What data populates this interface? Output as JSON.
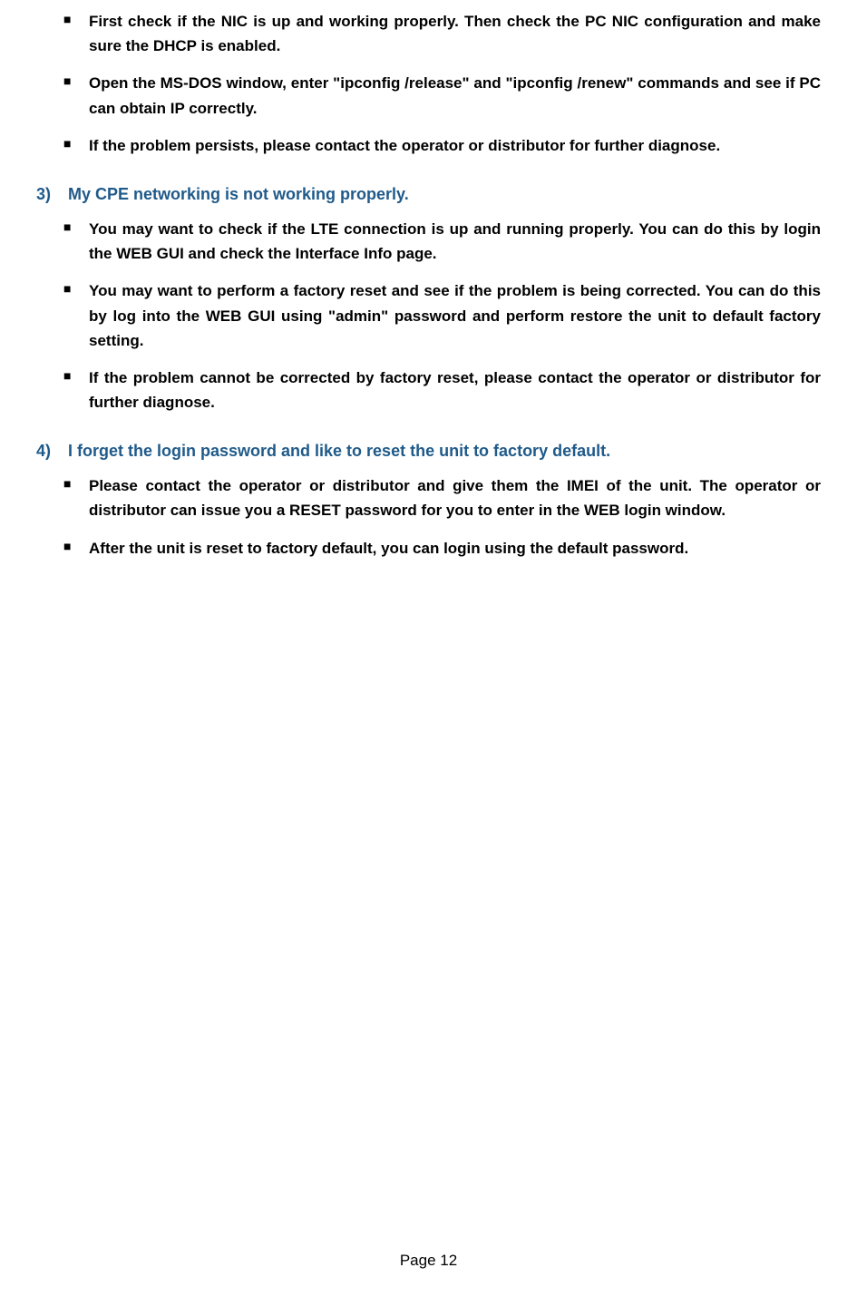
{
  "section2": {
    "bullets": [
      "First check if the NIC is up and working properly. Then check the PC NIC configuration and make sure the DHCP is enabled.",
      "Open the MS-DOS window, enter \"ipconfig /release\" and \"ipconfig /renew\" commands and see if PC can obtain IP correctly.",
      "If the problem persists, please contact the operator or distributor for further diagnose."
    ]
  },
  "section3": {
    "number": "3)",
    "title": "My CPE networking is not working properly.",
    "bullets": [
      "You may want to check if the LTE connection is up and running properly. You can do this by login the WEB GUI and check the Interface Info page.",
      "You may want to perform a factory reset and see if the problem is being corrected. You can do this by log into the WEB GUI using \"admin\" password and perform restore the unit to default factory setting.",
      "If the problem cannot be corrected by factory reset, please contact the operator or distributor for further diagnose."
    ]
  },
  "section4": {
    "number": "4)",
    "title": "I forget the login password and like to reset the unit to factory default.",
    "bullets": [
      "Please contact the operator or distributor and give them the IMEI of the unit. The operator or distributor can issue you a RESET password for you to enter in the WEB login window.",
      "After the unit is reset to factory default, you can login using the default password."
    ]
  },
  "footer": "Page 12"
}
